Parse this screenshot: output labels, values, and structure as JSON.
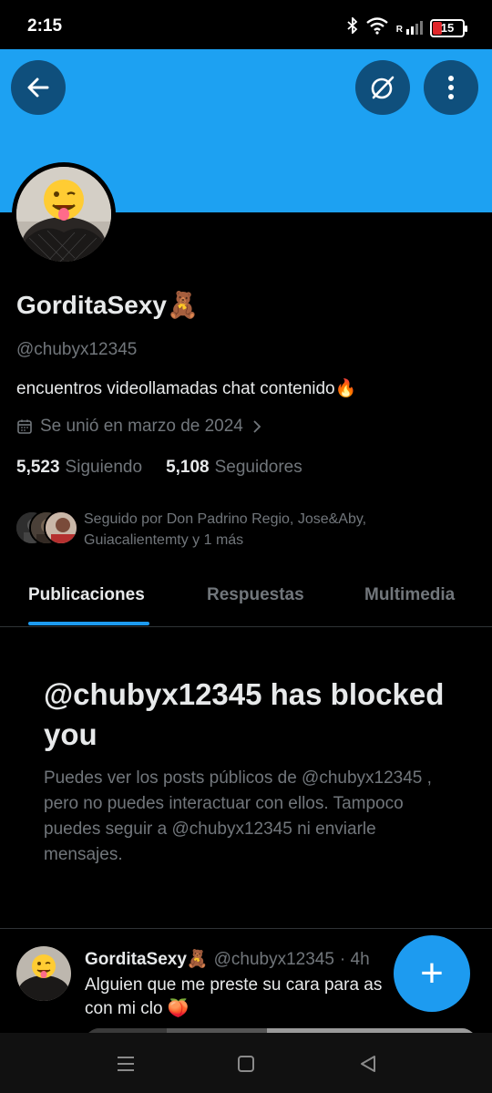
{
  "colors": {
    "banner": "#1da1f2",
    "accent": "#1d9bf0",
    "header_button_bg": "#0f4f7c",
    "battery_low": "#e0262a"
  },
  "status_bar": {
    "time": "2:15",
    "battery_level": "15",
    "network_indicator": "R",
    "icons": [
      "bluetooth-icon",
      "wifi-icon",
      "signal-icon",
      "battery-icon"
    ]
  },
  "header": {
    "back_icon": "back-arrow-icon",
    "grok_icon": "grok-icon",
    "more_icon": "more-vertical-icon"
  },
  "profile": {
    "name": "GorditaSexy🧸",
    "handle": "@chubyx12345",
    "bio": "encuentros videollamadas  chat contenido🔥",
    "joined": "Se unió en marzo de 2024",
    "following_count": "5,523",
    "following_label": "Siguiendo",
    "followers_count": "5,108",
    "followers_label": "Seguidores",
    "followed_by": "Seguido por Don Padrino Regio, Jose&Aby, Guiacalientemty y 1 más"
  },
  "tabs": [
    {
      "label": "Publicaciones",
      "active": true
    },
    {
      "label": "Respuestas",
      "active": false
    },
    {
      "label": "Multimedia",
      "active": false
    }
  ],
  "blocked": {
    "title": "@chubyx12345 has blocked you",
    "text": "Puedes ver los posts públicos de @chubyx12345 , pero no puedes interactuar con ellos. Tampoco puedes seguir a @chubyx12345 ni enviarle mensajes."
  },
  "post": {
    "author": "GorditaSexy🧸",
    "handle": "@chubyx12345",
    "time": "· 4h",
    "text": "Alguien que me preste su cara para as con mi clo 🍑"
  },
  "fab": {
    "label": "+"
  },
  "nav_bar": {
    "icons": [
      "menu-icon",
      "home-square-icon",
      "back-triangle-icon"
    ]
  }
}
